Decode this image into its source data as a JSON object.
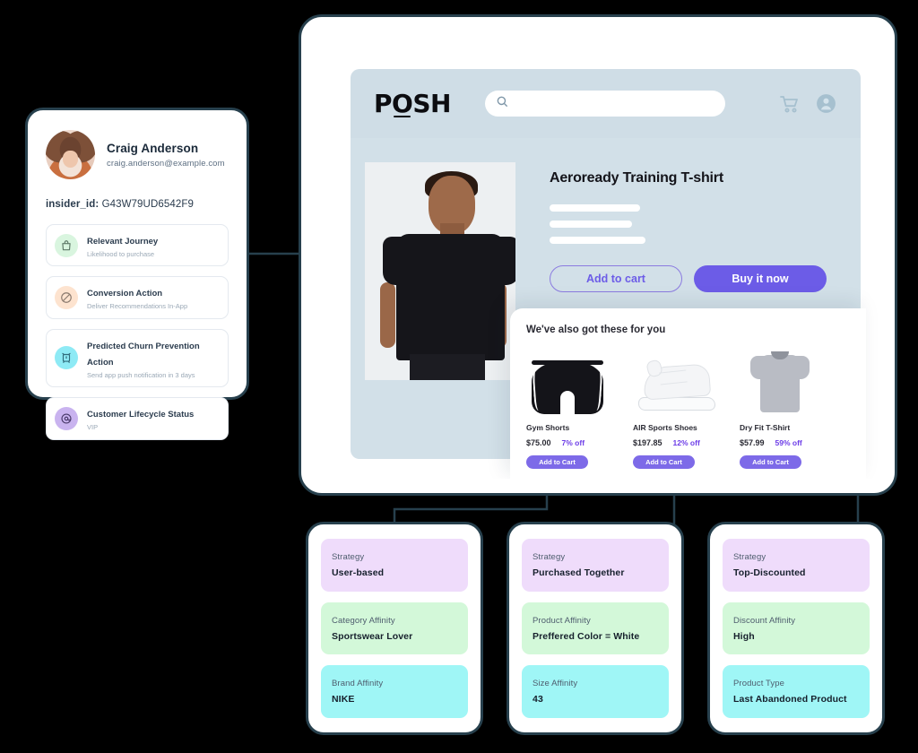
{
  "colors": {
    "page_background": "#000000",
    "frame_border": "#27404d",
    "shop_header_bg": "#cfdde6",
    "shop_body_bg": "#d2e0e8",
    "accent_purple": "#6c5ce7",
    "discount_purple": "#6c3ce7",
    "tile_purple": "#efdcfb",
    "tile_green": "#d3f8d9",
    "tile_cyan": "#9ff6f6"
  },
  "profile": {
    "name": "Craig Anderson",
    "email": "craig.anderson@example.com",
    "avatar_icon": "user-photo-avatar",
    "insider_id_label": "insider_id:",
    "insider_id_value": "G43W79UD6542F9",
    "attributes": [
      {
        "title": "Relevant Journey",
        "subtitle": "Likelihood to purchase",
        "icon": "shopping-bag-icon",
        "icon_bg": "#d9f5df",
        "icon_color": "#5f7a68"
      },
      {
        "title": "Conversion Action",
        "subtitle": "Deliver Recommendations In-App",
        "icon": "no-entry-icon",
        "icon_bg": "#fde3cf",
        "icon_color": "#8a7a6e"
      },
      {
        "title": "Predicted Churn Prevention Action",
        "subtitle": "Send app push notification in 3 days",
        "icon": "alarm-clock-icon",
        "icon_bg": "#8eeaf5",
        "icon_color": "#2f6b7a"
      },
      {
        "title": "Customer Lifecycle Status",
        "subtitle": "VIP",
        "icon": "at-badge-icon",
        "icon_bg": "#c9b3ef",
        "icon_color": "#4a3a6b"
      }
    ]
  },
  "browser": {
    "logo_pre": "P",
    "logo_o": "O",
    "logo_post": "SH",
    "search_placeholder": "",
    "search_value": "",
    "search_icon": "search-icon",
    "cart_icon": "shopping-cart-icon",
    "account_icon": "user-account-icon",
    "product": {
      "image_alt": "male-model-black-tshirt",
      "title": "Aeroready Training T-shirt",
      "add_to_cart_label": "Add to cart",
      "buy_now_label": "Buy it now"
    },
    "recommendations": {
      "heading": "We've also got these for you",
      "items": [
        {
          "name": "Gym Shorts",
          "price": "$75.00",
          "discount": "7% off",
          "button_label": "Add to Cart",
          "image_alt": "black-gym-shorts"
        },
        {
          "name": "AIR Sports Shoes",
          "price": "$197.85",
          "discount": "12% off",
          "button_label": "Add to Cart",
          "image_alt": "white-sports-shoe"
        },
        {
          "name": "Dry Fit T-Shirt",
          "price": "$57.99",
          "discount": "59% off",
          "button_label": "Add to Cart",
          "image_alt": "grey-dry-fit-tshirt"
        }
      ]
    }
  },
  "strategies": [
    {
      "tiles": [
        {
          "label": "Strategy",
          "value": "User-based",
          "bg": "#efdcfb"
        },
        {
          "label": "Category Affinity",
          "value": "Sportswear Lover",
          "bg": "#d3f8d9"
        },
        {
          "label": "Brand Affinity",
          "value": "NIKE",
          "bg": "#9ff6f6"
        }
      ]
    },
    {
      "tiles": [
        {
          "label": "Strategy",
          "value": "Purchased Together",
          "bg": "#efdcfb"
        },
        {
          "label": "Product Affinity",
          "value": "Preffered Color = White",
          "bg": "#d3f8d9"
        },
        {
          "label": "Size Affinity",
          "value": "43",
          "bg": "#9ff6f6"
        }
      ]
    },
    {
      "tiles": [
        {
          "label": "Strategy",
          "value": "Top-Discounted",
          "bg": "#efdcfb"
        },
        {
          "label": "Discount Affinity",
          "value": "High",
          "bg": "#d3f8d9"
        },
        {
          "label": "Product Type",
          "value": "Last Abandoned Product",
          "bg": "#9ff6f6"
        }
      ]
    }
  ]
}
